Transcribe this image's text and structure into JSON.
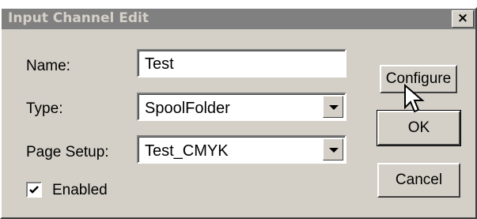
{
  "dialog": {
    "title": "Input Channel Edit",
    "close_label": "×"
  },
  "form": {
    "name_label": "Name:",
    "name_value": "Test",
    "type_label": "Type:",
    "type_value": "SpoolFolder",
    "page_setup_label": "Page Setup:",
    "page_setup_value": "Test_CMYK",
    "enabled_label": "Enabled",
    "enabled_checked": true
  },
  "buttons": {
    "configure": "Configure",
    "ok": "OK",
    "cancel": "Cancel"
  },
  "icons": {
    "close": "close-icon",
    "dropdown": "chevron-down-icon",
    "check": "checkmark-icon",
    "cursor": "mouse-pointer-icon"
  },
  "colors": {
    "window_face": "#d4d0c8",
    "titlebar_inactive": "#808080",
    "title_text": "#d4d0c8"
  }
}
